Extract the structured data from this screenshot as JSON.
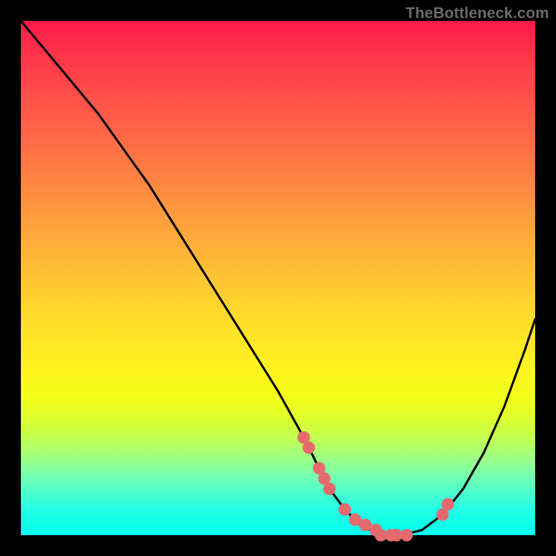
{
  "watermark": "TheBottleneck.com",
  "chart_data": {
    "type": "line",
    "title": "",
    "xlabel": "",
    "ylabel": "",
    "xlim": [
      0,
      100
    ],
    "ylim": [
      0,
      100
    ],
    "series": [
      {
        "name": "bottleneck-curve",
        "x": [
          0,
          5,
          10,
          15,
          20,
          25,
          30,
          35,
          40,
          45,
          50,
          55,
          58,
          60,
          63,
          66,
          70,
          74,
          78,
          82,
          86,
          90,
          94,
          98,
          100
        ],
        "y": [
          100,
          94,
          88,
          82,
          75,
          68,
          60,
          52,
          44,
          36,
          28,
          19,
          13,
          9,
          5,
          2,
          0,
          0,
          1,
          4,
          9,
          16,
          25,
          36,
          42
        ]
      }
    ],
    "points": {
      "name": "sample-dots",
      "x": [
        55,
        56,
        58,
        59,
        60,
        63,
        65,
        67,
        69,
        70,
        72,
        73,
        75,
        82,
        83
      ],
      "y": [
        19,
        17,
        13,
        11,
        9,
        5,
        3,
        2,
        1,
        0,
        0,
        0,
        0,
        4,
        6
      ]
    }
  }
}
